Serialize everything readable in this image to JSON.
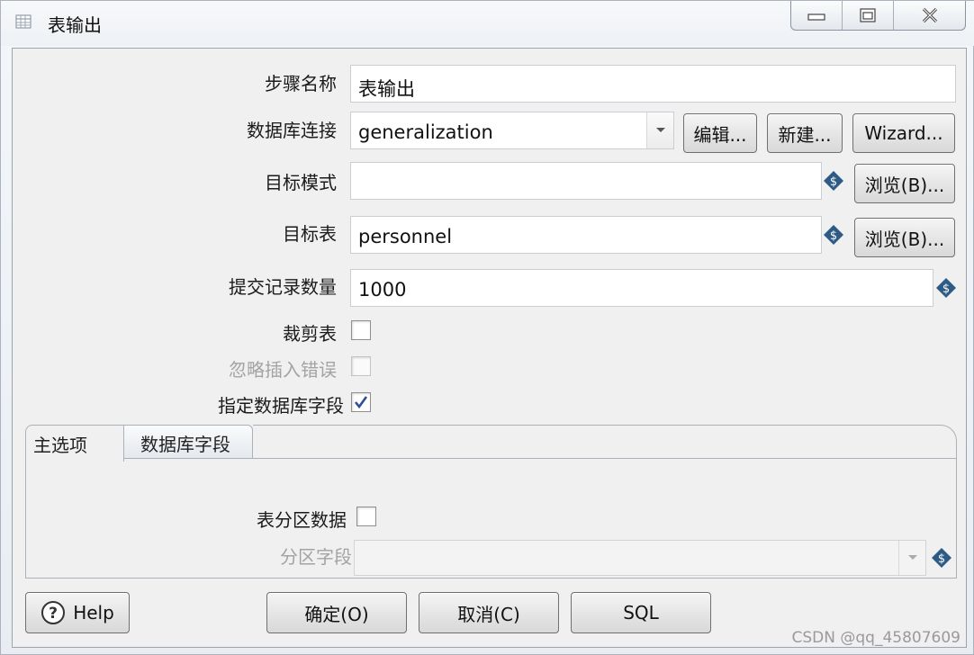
{
  "window": {
    "title": "表输出",
    "controls": [
      "minimize-icon",
      "maximize-icon",
      "close-icon"
    ]
  },
  "form": {
    "step_name_label": "步骤名称",
    "step_name_value": "表输出",
    "db_conn_label": "数据库连接",
    "db_conn_value": "generalization",
    "edit_button": "编辑...",
    "new_button": "新建...",
    "wizard_button": "Wizard...",
    "target_schema_label": "目标模式",
    "target_schema_value": "",
    "browse_button_1": "浏览(B)...",
    "target_table_label": "目标表",
    "target_table_value": "personnel",
    "browse_button_2": "浏览(B)...",
    "commit_size_label": "提交记录数量",
    "commit_size_value": "1000",
    "truncate_label": "裁剪表",
    "truncate_checked": false,
    "ignore_errors_label": "忽略插入错误",
    "ignore_errors_checked": false,
    "specify_fields_label": "指定数据库字段",
    "specify_fields_checked": true
  },
  "tabs": [
    {
      "label": "主选项",
      "active": true
    },
    {
      "label": "数据库字段",
      "active": false
    }
  ],
  "main_options": {
    "partition_label": "表分区数据",
    "partition_checked": false,
    "partition_field_label": "分区字段",
    "partition_field_value": ""
  },
  "footer": {
    "help_button": "Help",
    "ok_button": "确定(O)",
    "cancel_button": "取消(C)",
    "sql_button": "SQL"
  },
  "watermark": "CSDN @qq_45807609",
  "colors": {
    "variable_icon": "#2e5a86",
    "check_mark": "#2b4f9c"
  }
}
